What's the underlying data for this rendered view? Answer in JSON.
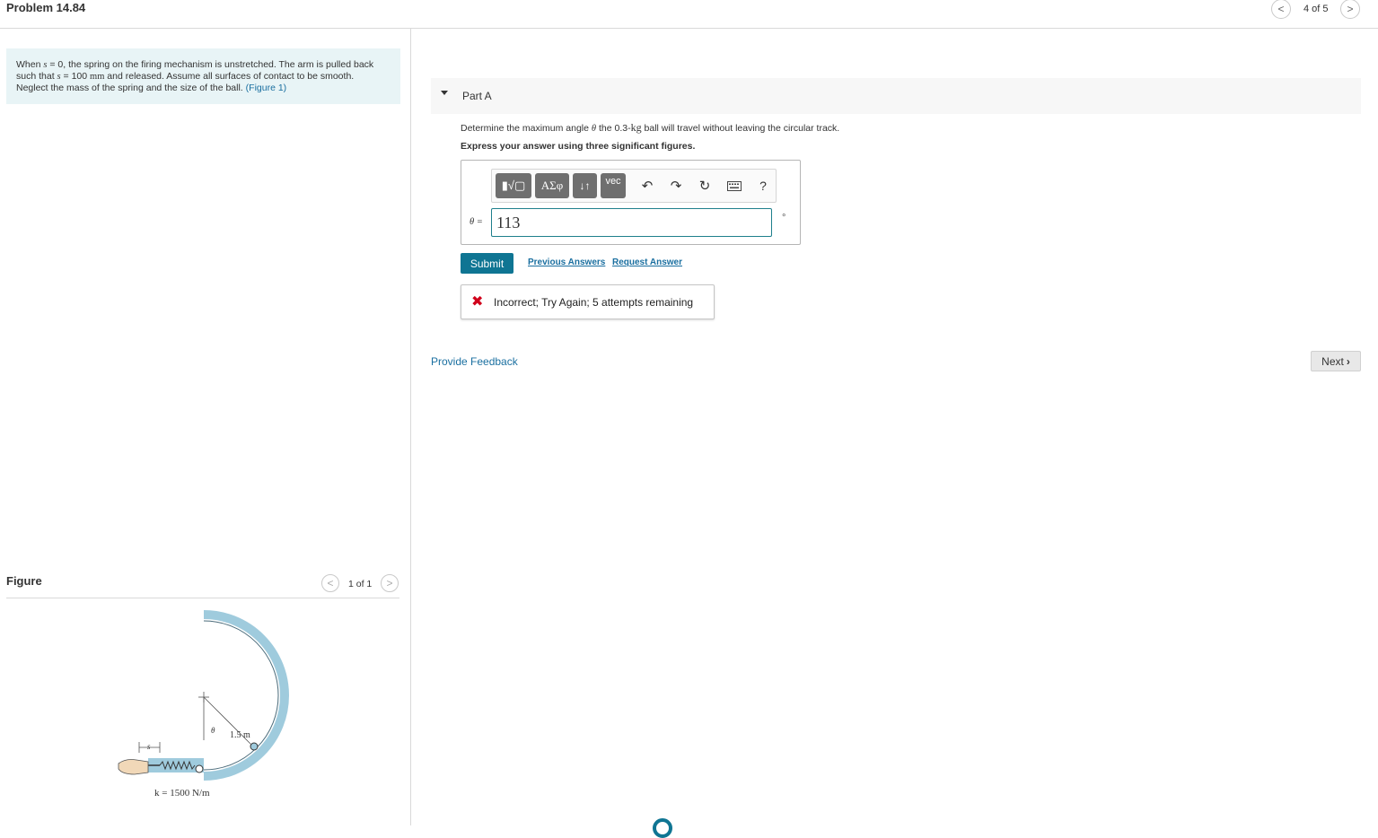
{
  "header": {
    "problem_title": "Problem 14.84",
    "page_count": "4 of 5",
    "prev_icon": "chevron-left-icon",
    "next_icon": "chevron-right-icon"
  },
  "problem": {
    "line1_a": "When ",
    "var_s": "s",
    "line1_b": " = 0, the spring on the firing mechanism is unstretched. The arm is pulled back",
    "line2_a": "such that ",
    "line2_b": " = 100 ",
    "unit_mm": "mm",
    "line2_c": " and released. Assume all surfaces of contact to be smooth.",
    "line3": "Neglect the mass of the spring and the size of the ball. ",
    "figure_link": "(Figure 1)"
  },
  "figure": {
    "label": "Figure",
    "count": "1 of 1",
    "radius_label": "1.5 m",
    "theta_label": "θ",
    "s_label": "s",
    "k_label": "k = 1500 N/m",
    "track_color": "#9fcbdd"
  },
  "part": {
    "label": "Part A",
    "question_a": "Determine the maximum angle ",
    "theta": "θ",
    "question_b": " the 0.3-",
    "kg": "kg",
    "question_c": " ball will travel without leaving the circular track.",
    "instruction": "Express your answer using three significant figures."
  },
  "toolbar": {
    "templates": "▮√▢",
    "greek": "ΑΣφ",
    "arrows": "↓↑",
    "vec": "vec",
    "undo_icon": "undo-icon",
    "redo_icon": "redo-icon",
    "reset_icon": "reset-icon",
    "keyboard_icon": "keyboard-icon",
    "help": "?"
  },
  "answer": {
    "label": "θ =",
    "value": "113",
    "unit": "°"
  },
  "actions": {
    "submit": "Submit",
    "previous_answers": "Previous Answers",
    "request_answer": "Request Answer"
  },
  "feedback": {
    "icon": "x-icon",
    "text": "Incorrect; Try Again; 5 attempts remaining",
    "color": "#d0021b"
  },
  "footer": {
    "provide_feedback": "Provide Feedback",
    "next": "Next"
  },
  "colors": {
    "accent": "#0f7593",
    "link": "#1a6fa0",
    "problem_bg": "#e8f4f6"
  }
}
